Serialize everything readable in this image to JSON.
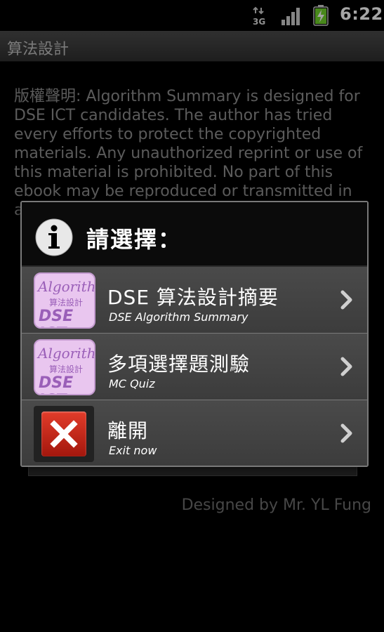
{
  "status_bar": {
    "network_label": "3G",
    "time": "6:22"
  },
  "app": {
    "title": "算法設計"
  },
  "background": {
    "body_text": "版權聲明: Algorithm Summary is designed for DSE ICT candidates. The author has tried every efforts to protect the copyrighted materials. Any unauthorized reprint or use of this material is prohibited.  No part of this ebook may be reproduced or transmitted in any form or by any",
    "footer": "Designed by Mr. YL Fung"
  },
  "dialog": {
    "title": "請選擇：",
    "items": [
      {
        "label": "DSE 算法設計摘要",
        "sublabel": "DSE Algorithm Summary",
        "icon": "algorithm-icon",
        "icon_text": [
          "Algorithm",
          "算法設計",
          "DSE ICT"
        ]
      },
      {
        "label": "多項選擇題測驗",
        "sublabel": "MC Quiz",
        "icon": "algorithm-icon",
        "icon_text": [
          "Algorithm",
          "算法設計",
          "DSE ICT"
        ]
      },
      {
        "label": "離開",
        "sublabel": "Exit now",
        "icon": "exit-x-icon"
      }
    ]
  },
  "colors": {
    "dialog_item_bg": "#444444",
    "icon_bg": "#e9c6ef",
    "icon_text": "#9a5fb8",
    "exit_red": "#d0301f"
  }
}
